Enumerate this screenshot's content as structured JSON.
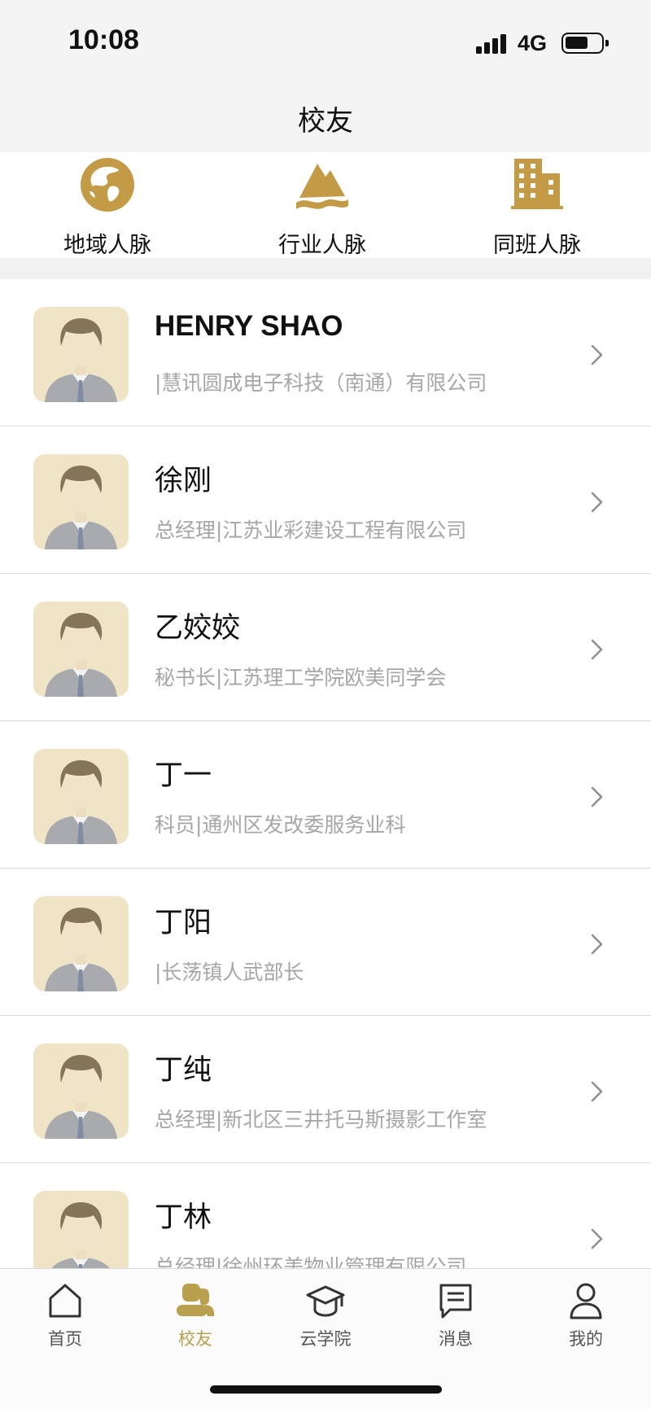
{
  "status_bar": {
    "time": "10:08",
    "network": "4G"
  },
  "header": {
    "title": "校友"
  },
  "categories": [
    {
      "label": "地域人脉",
      "icon": "globe-icon"
    },
    {
      "label": "行业人脉",
      "icon": "mountain-icon"
    },
    {
      "label": "同班人脉",
      "icon": "building-icon"
    }
  ],
  "alumni": [
    {
      "name": "HENRY SHAO",
      "detail": "|慧讯圆成电子科技（南通）有限公司"
    },
    {
      "name": "徐刚",
      "detail": "总经理|江苏业彩建设工程有限公司"
    },
    {
      "name": "乙姣姣",
      "detail": "秘书长|江苏理工学院欧美同学会"
    },
    {
      "name": "丁一",
      "detail": "科员|通州区发改委服务业科"
    },
    {
      "name": "丁阳",
      "detail": "|长荡镇人武部长"
    },
    {
      "name": "丁纯",
      "detail": "总经理|新北区三井托马斯摄影工作室"
    },
    {
      "name": "丁林",
      "detail": "总经理|徐州环美物业管理有限公司"
    }
  ],
  "tabs": [
    {
      "label": "首页",
      "icon": "home-icon"
    },
    {
      "label": "校友",
      "icon": "alumni-icon"
    },
    {
      "label": "云学院",
      "icon": "graduation-cap-icon"
    },
    {
      "label": "消息",
      "icon": "message-icon"
    },
    {
      "label": "我的",
      "icon": "profile-icon"
    }
  ],
  "active_tab": "校友",
  "colors": {
    "accent": "#b8a04f",
    "icon_gold": "#c39a45",
    "secondary_text": "#a6a6a6"
  }
}
